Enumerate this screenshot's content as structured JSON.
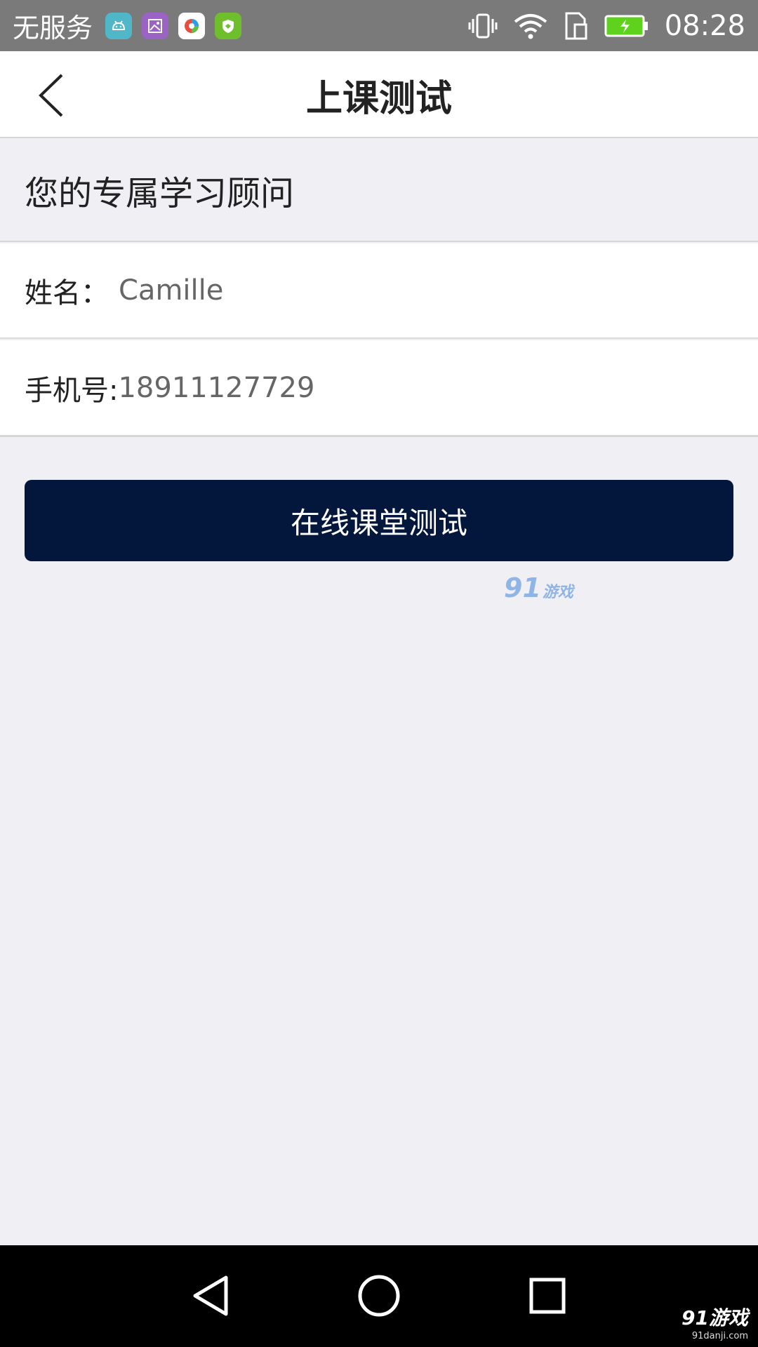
{
  "status_bar": {
    "carrier": "无服务",
    "time": "08:28",
    "notification_icons": [
      "android-icon",
      "gallery-icon",
      "app-icon",
      "shield-icon"
    ]
  },
  "header": {
    "title": "上课测试",
    "back_icon": "back-chevron-icon"
  },
  "advisor": {
    "heading": "您的专属学习顾问",
    "name_label": "姓名：",
    "name_value": "Camille",
    "phone_label": "手机号:",
    "phone_value": "18911127729"
  },
  "actions": {
    "test_button_label": "在线课堂测试"
  },
  "watermark": {
    "number": "91",
    "text": "游戏"
  },
  "corner_watermark": {
    "main": "91游戏",
    "sub": "91danji.com"
  },
  "colors": {
    "primary_button": "#03173d",
    "background": "#efeff4",
    "status_bar": "#7a7a7a",
    "battery": "#5fd21e"
  }
}
